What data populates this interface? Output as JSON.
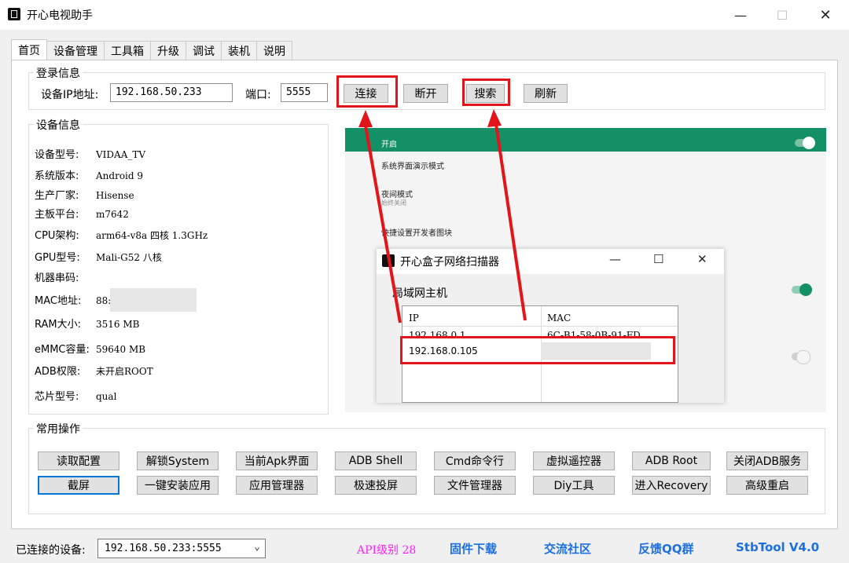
{
  "window": {
    "title": "开心电视助手"
  },
  "tabs": [
    "首页",
    "设备管理",
    "工具箱",
    "升级",
    "调试",
    "装机",
    "说明"
  ],
  "login": {
    "legend": "登录信息",
    "ip_label": "设备IP地址:",
    "ip_value": "192.168.50.233",
    "port_label": "端口:",
    "port_value": "5555",
    "connect": "连接",
    "disconnect": "断开",
    "search": "搜索",
    "refresh": "刷新"
  },
  "device": {
    "legend": "设备信息",
    "rows": [
      {
        "k": "设备型号:",
        "v": "VIDAA_TV"
      },
      {
        "k": "系统版本:",
        "v": "Android 9"
      },
      {
        "k": "生产厂家:",
        "v": "Hisense"
      },
      {
        "k": "主板平台:",
        "v": "m7642"
      },
      {
        "k": "CPU架构:",
        "v": "arm64-v8a 四核 1.3GHz"
      },
      {
        "k": "GPU型号:",
        "v": "Mali-G52 八核"
      },
      {
        "k": "机器串码:",
        "v": ""
      },
      {
        "k": "MAC地址:",
        "v": "88:"
      },
      {
        "k": "RAM大小:",
        "v": "3516 MB"
      },
      {
        "k": "eMMC容量:",
        "v": "59640 MB"
      },
      {
        "k": "ADB权限:",
        "v": "未开启ROOT"
      },
      {
        "k": "芯片型号:",
        "v": "qual"
      }
    ]
  },
  "screenshot": {
    "items": [
      "开启",
      "系统界面演示模式",
      "夜间模式",
      "始终关闭",
      "快捷设置开发者图块"
    ]
  },
  "scanner": {
    "title": "开心盒子网络扫描器",
    "group": "局域网主机",
    "col_ip": "IP",
    "col_mac": "MAC",
    "row1_ip": "192.168.0.1",
    "row1_mac": "6C-B1-58-0B-91-FD",
    "row2_ip": "192.168.0.105"
  },
  "ops": {
    "legend": "常用操作",
    "row1": [
      "读取配置",
      "解锁System",
      "当前Apk界面",
      "ADB Shell",
      "Cmd命令行",
      "虚拟遥控器",
      "ADB  Root",
      "关闭ADB服务"
    ],
    "row2": [
      "截屏",
      "一键安装应用",
      "应用管理器",
      "极速投屏",
      "文件管理器",
      "Diy工具",
      "进入Recovery",
      "高级重启"
    ]
  },
  "status": {
    "label": "已连接的设备:",
    "device": "192.168.50.233:5555",
    "api": "API级别 28",
    "links": [
      "固件下载",
      "交流社区",
      "反馈QQ群",
      "StbTool V4.0"
    ]
  },
  "colors": {
    "accent": "#e3151a",
    "link": "#1d6fe0",
    "tv_green": "#139065",
    "api": "#ff22ff"
  }
}
